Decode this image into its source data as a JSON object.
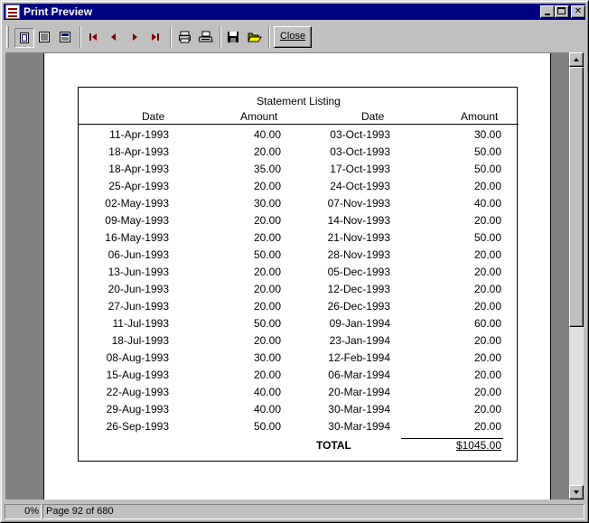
{
  "window": {
    "title": "Print Preview"
  },
  "toolbar": {
    "close_label": "Close"
  },
  "status": {
    "percent": "0%",
    "page_text": "Page 92 of 680"
  },
  "report": {
    "title": "Statement Listing",
    "headers": {
      "date1": "Date",
      "amount1": "Amount",
      "date2": "Date",
      "amount2": "Amount"
    },
    "rows": [
      {
        "d1": "11-Apr-1993",
        "a1": "40.00",
        "d2": "03-Oct-1993",
        "a2": "30.00"
      },
      {
        "d1": "18-Apr-1993",
        "a1": "20.00",
        "d2": "03-Oct-1993",
        "a2": "50.00"
      },
      {
        "d1": "18-Apr-1993",
        "a1": "35.00",
        "d2": "17-Oct-1993",
        "a2": "50.00"
      },
      {
        "d1": "25-Apr-1993",
        "a1": "20.00",
        "d2": "24-Oct-1993",
        "a2": "20.00"
      },
      {
        "d1": "02-May-1993",
        "a1": "30.00",
        "d2": "07-Nov-1993",
        "a2": "40.00"
      },
      {
        "d1": "09-May-1993",
        "a1": "20.00",
        "d2": "14-Nov-1993",
        "a2": "20.00"
      },
      {
        "d1": "16-May-1993",
        "a1": "20.00",
        "d2": "21-Nov-1993",
        "a2": "50.00"
      },
      {
        "d1": "06-Jun-1993",
        "a1": "50.00",
        "d2": "28-Nov-1993",
        "a2": "20.00"
      },
      {
        "d1": "13-Jun-1993",
        "a1": "20.00",
        "d2": "05-Dec-1993",
        "a2": "20.00"
      },
      {
        "d1": "20-Jun-1993",
        "a1": "20.00",
        "d2": "12-Dec-1993",
        "a2": "20.00"
      },
      {
        "d1": "27-Jun-1993",
        "a1": "20.00",
        "d2": "26-Dec-1993",
        "a2": "20.00"
      },
      {
        "d1": "11-Jul-1993",
        "a1": "50.00",
        "d2": "09-Jan-1994",
        "a2": "60.00"
      },
      {
        "d1": "18-Jul-1993",
        "a1": "20.00",
        "d2": "23-Jan-1994",
        "a2": "20.00"
      },
      {
        "d1": "08-Aug-1993",
        "a1": "30.00",
        "d2": "12-Feb-1994",
        "a2": "20.00"
      },
      {
        "d1": "15-Aug-1993",
        "a1": "20.00",
        "d2": "06-Mar-1994",
        "a2": "20.00"
      },
      {
        "d1": "22-Aug-1993",
        "a1": "40.00",
        "d2": "20-Mar-1994",
        "a2": "20.00"
      },
      {
        "d1": "29-Aug-1993",
        "a1": "40.00",
        "d2": "30-Mar-1994",
        "a2": "20.00"
      },
      {
        "d1": "26-Sep-1993",
        "a1": "50.00",
        "d2": "30-Mar-1994",
        "a2": "20.00"
      }
    ],
    "total_label": "TOTAL",
    "total_value": "$1045.00"
  }
}
